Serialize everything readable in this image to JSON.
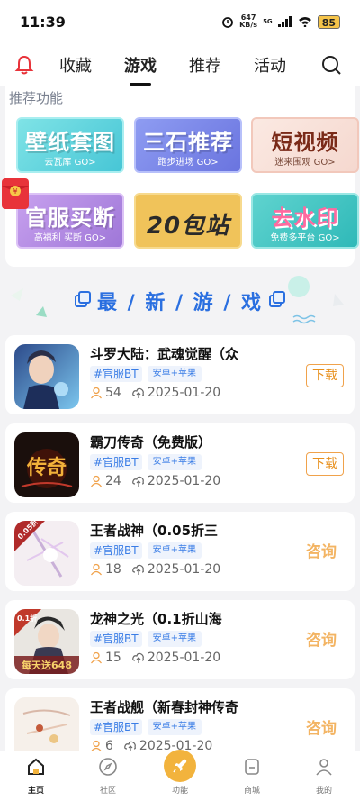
{
  "status_bar": {
    "time": "11:39",
    "net_speed_value": "647",
    "net_speed_unit": "KB/s",
    "signal_label": "5G",
    "battery": "85"
  },
  "top_nav": {
    "tabs": [
      {
        "label": "收藏",
        "active": false
      },
      {
        "label": "游戏",
        "active": true
      },
      {
        "label": "推荐",
        "active": false
      },
      {
        "label": "活动",
        "active": false
      }
    ]
  },
  "functions": {
    "title": "推荐功能",
    "tiles": [
      {
        "title": "壁纸套图",
        "subtitle": "去瓦库  GO>"
      },
      {
        "title": "三石推荐",
        "subtitle": "跑步进场 GO>"
      },
      {
        "title": "短视频",
        "subtitle": "迷来围观 GO>"
      },
      {
        "title": "官服买断",
        "subtitle": "高福利 买断 GO>"
      },
      {
        "title": "20包站",
        "subtitle": ""
      },
      {
        "title": "去水印",
        "subtitle": "免费多平台 GO>"
      }
    ]
  },
  "section": {
    "title": "最 / 新 / 游 / 戏"
  },
  "games": [
    {
      "name": "斗罗大陆：武魂觉醒（众",
      "tag_bt": "#官服BT",
      "tag_os": "安卓+苹果",
      "count": "54",
      "date": "2025-01-20",
      "action": "下载"
    },
    {
      "name": "霸刀传奇（免费版）",
      "tag_bt": "#官服BT",
      "tag_os": "安卓+苹果",
      "count": "24",
      "date": "2025-01-20",
      "action": "下载"
    },
    {
      "name": "王者战神（0.05折三",
      "tag_bt": "#官服BT",
      "tag_os": "安卓+苹果",
      "count": "18",
      "date": "2025-01-20",
      "action": "咨询"
    },
    {
      "name": "龙神之光（0.1折山海",
      "tag_bt": "#官服BT",
      "tag_os": "安卓+苹果",
      "count": "15",
      "date": "2025-01-20",
      "action": "咨询"
    },
    {
      "name": "王者战舰（新春封神传奇",
      "tag_bt": "#官服BT",
      "tag_os": "安卓+苹果",
      "count": "6",
      "date": "2025-01-20",
      "action": "咨询"
    }
  ],
  "icon_badges": {
    "game3": "0.05折",
    "game4": "0.1折",
    "game4_banner": "每天送648",
    "game2_logo": "传奇"
  },
  "tab_bar": {
    "items": [
      {
        "label": "主页",
        "icon": "home-icon",
        "active": true
      },
      {
        "label": "社区",
        "icon": "compass-icon",
        "active": false
      },
      {
        "label": "功能",
        "icon": "rocket-icon",
        "active": false
      },
      {
        "label": "商城",
        "icon": "shop-icon",
        "active": false
      },
      {
        "label": "我的",
        "icon": "user-icon",
        "active": false
      }
    ]
  },
  "colors": {
    "accent_blue": "#2a6fe0",
    "download_orange": "#e8901d",
    "consult_orange": "#f3b463",
    "tab_center": "#f2b33d"
  }
}
